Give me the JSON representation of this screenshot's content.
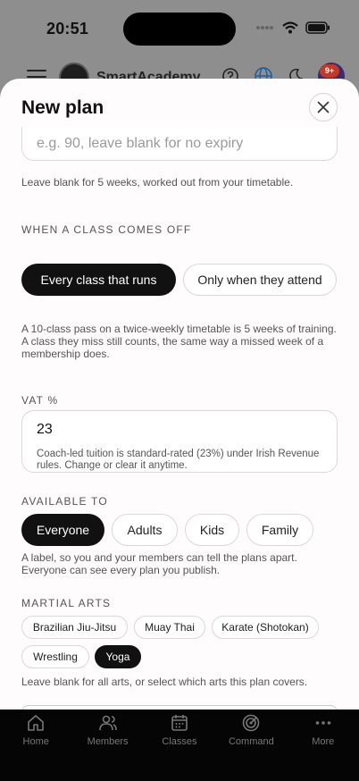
{
  "status": {
    "time": "20:51"
  },
  "header": {
    "app_name": "SmartAcademy",
    "notifications_badge": "9+"
  },
  "sheet": {
    "title": "New plan",
    "expiry": {
      "placeholder": "e.g. 90, leave blank for no expiry",
      "help": "Leave blank for 5 weeks, worked out from your timetable."
    },
    "class_off": {
      "label": "WHEN A CLASS COMES OFF",
      "options": [
        "Every class that runs",
        "Only when they attend"
      ],
      "selected": "Every class that runs",
      "help": "A 10-class pass on a twice-weekly timetable is 5 weeks of training. A class they miss still counts, the same way a missed week of a membership does."
    },
    "vat": {
      "label": "VAT %",
      "value": "23",
      "note": "Coach-led tuition is standard-rated (23%) under Irish Revenue rules. Change or clear it anytime."
    },
    "available_to": {
      "label": "AVAILABLE TO",
      "options": [
        "Everyone",
        "Adults",
        "Kids",
        "Family"
      ],
      "selected": "Everyone",
      "help": "A label, so you and your members can tell the plans apart. Everyone can see every plan you publish."
    },
    "martial_arts": {
      "label": "MARTIAL ARTS",
      "options": [
        "Brazilian Jiu-Jitsu",
        "Muay Thai",
        "Karate (Shotokan)",
        "Wrestling",
        "Yoga"
      ],
      "selected": [
        "Yoga"
      ],
      "help": "Leave blank for all arts, or select which arts this plan covers."
    }
  },
  "tabs": [
    {
      "label": "Home",
      "icon": "home-icon"
    },
    {
      "label": "Members",
      "icon": "members-icon"
    },
    {
      "label": "Classes",
      "icon": "calendar-icon"
    },
    {
      "label": "Command",
      "icon": "radar-icon"
    },
    {
      "label": "More",
      "icon": "more-icon"
    }
  ],
  "colors": {
    "accent": "#111111",
    "sheet_bg": "#fefcfc",
    "tab_bar_bg": "#050505",
    "badge": "#c0392b"
  }
}
